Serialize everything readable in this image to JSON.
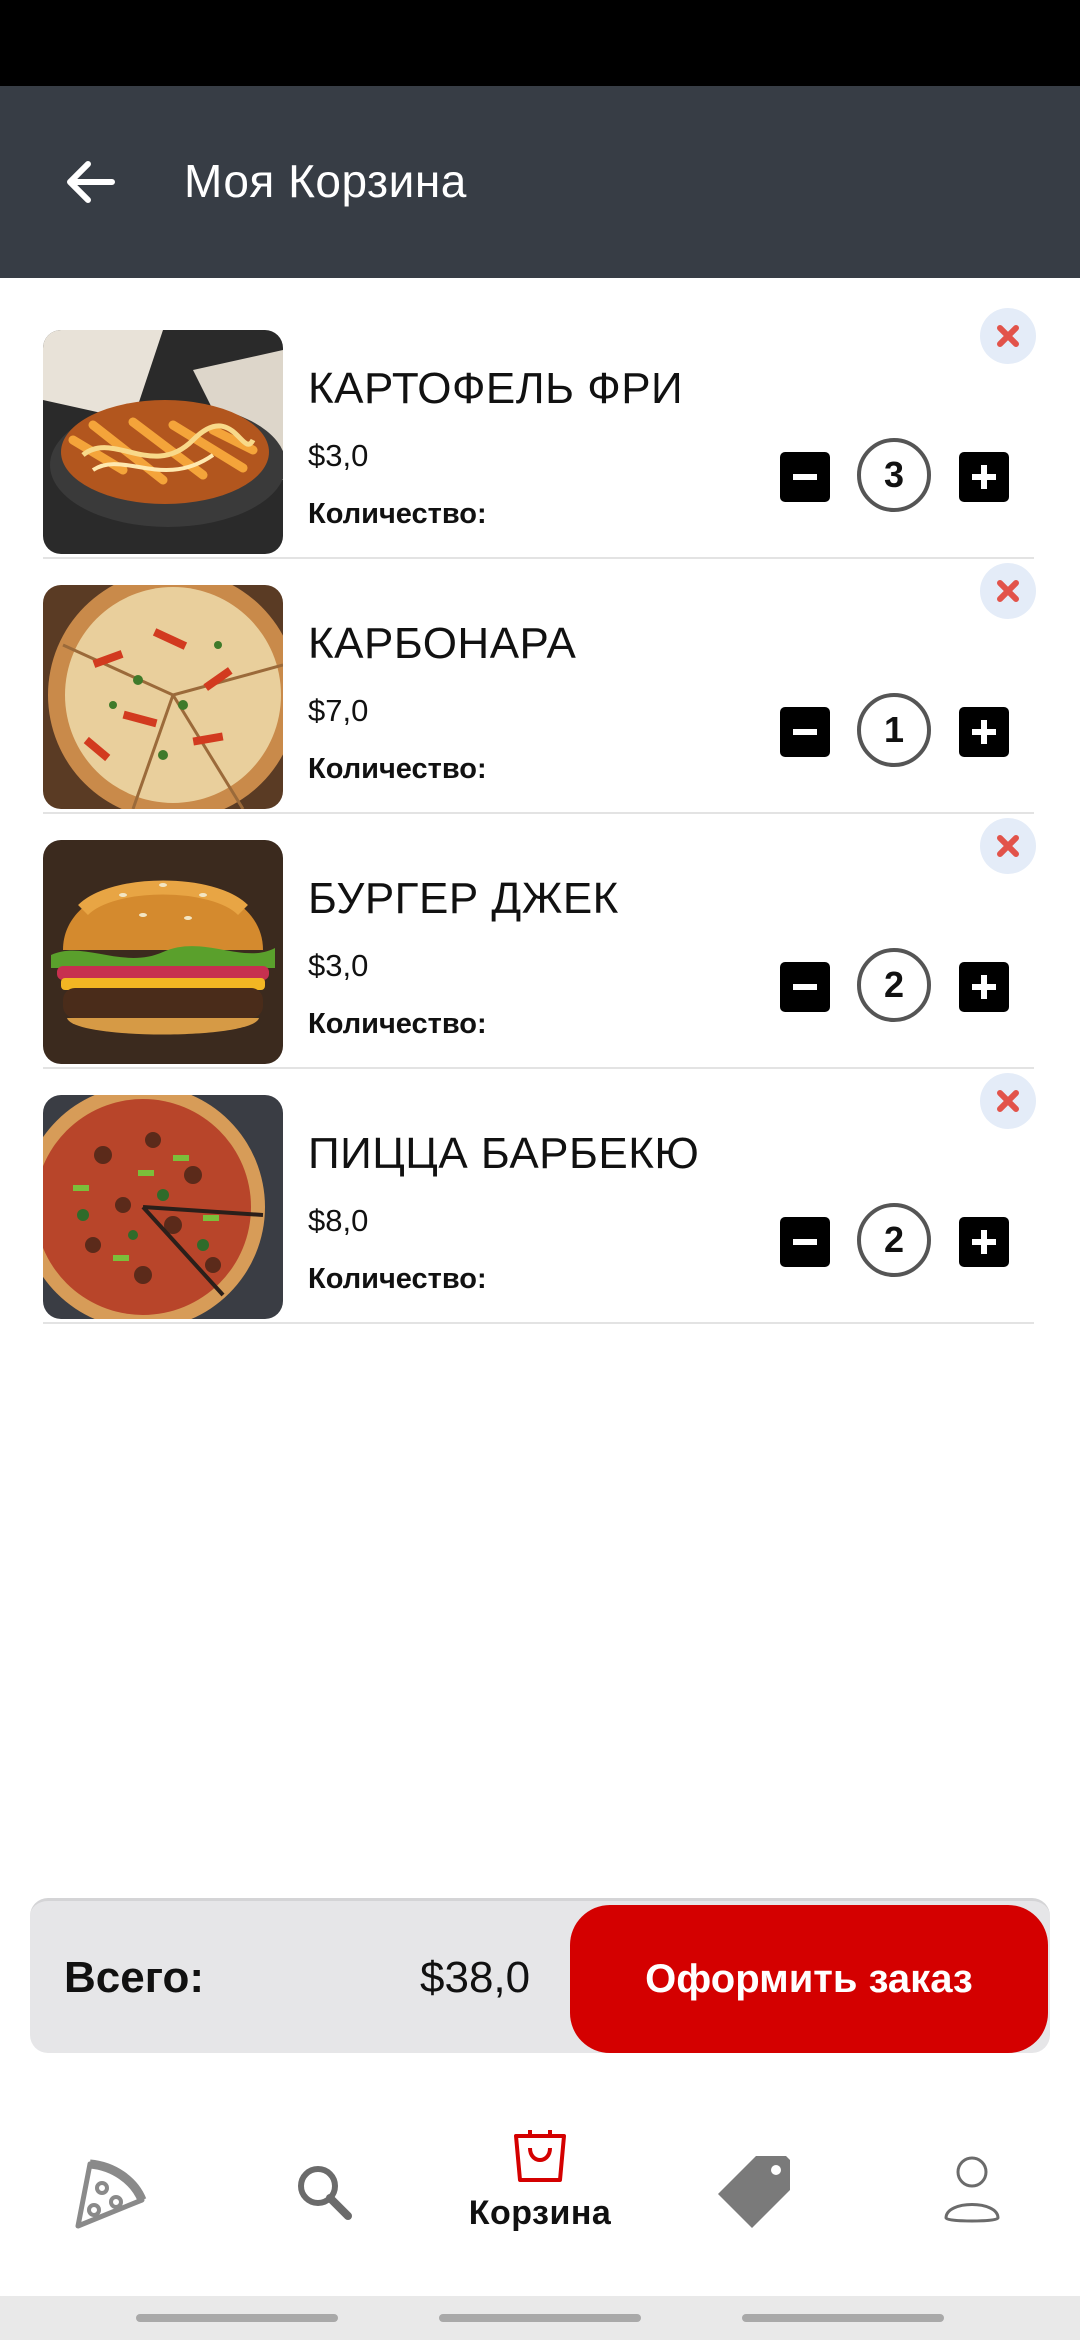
{
  "app_bar": {
    "title": "Моя Корзина",
    "back_icon": "arrow-left-icon"
  },
  "cart": {
    "quantity_label": "Количество:",
    "items": [
      {
        "name": "КАРТОФЕЛЬ ФРИ",
        "price": "$3,0",
        "quantity": "3",
        "image": "fries-photo"
      },
      {
        "name": "КАРБОНАРА",
        "price": "$7,0",
        "quantity": "1",
        "image": "pizza-carbonara-photo"
      },
      {
        "name": "БУРГЕР ДЖЕК",
        "price": "$3,0",
        "quantity": "2",
        "image": "burger-photo"
      },
      {
        "name": "ПИЦЦА БАРБЕКЮ",
        "price": "$8,0",
        "quantity": "2",
        "image": "pizza-bbq-photo"
      }
    ]
  },
  "summary": {
    "total_label": "Всего:",
    "total_value": "$38,0",
    "checkout_label": "Оформить заказ"
  },
  "bottom_nav": {
    "items": [
      {
        "icon": "pizza-icon",
        "label": ""
      },
      {
        "icon": "search-icon",
        "label": ""
      },
      {
        "icon": "shopping-bag-icon",
        "label": "Корзина",
        "active": true
      },
      {
        "icon": "tag-icon",
        "label": ""
      },
      {
        "icon": "profile-icon",
        "label": ""
      }
    ]
  },
  "colors": {
    "app_bar": "#373d45",
    "accent": "#d40000",
    "remove_icon": "#e2534a",
    "summary_bg": "#e6e6e8"
  }
}
